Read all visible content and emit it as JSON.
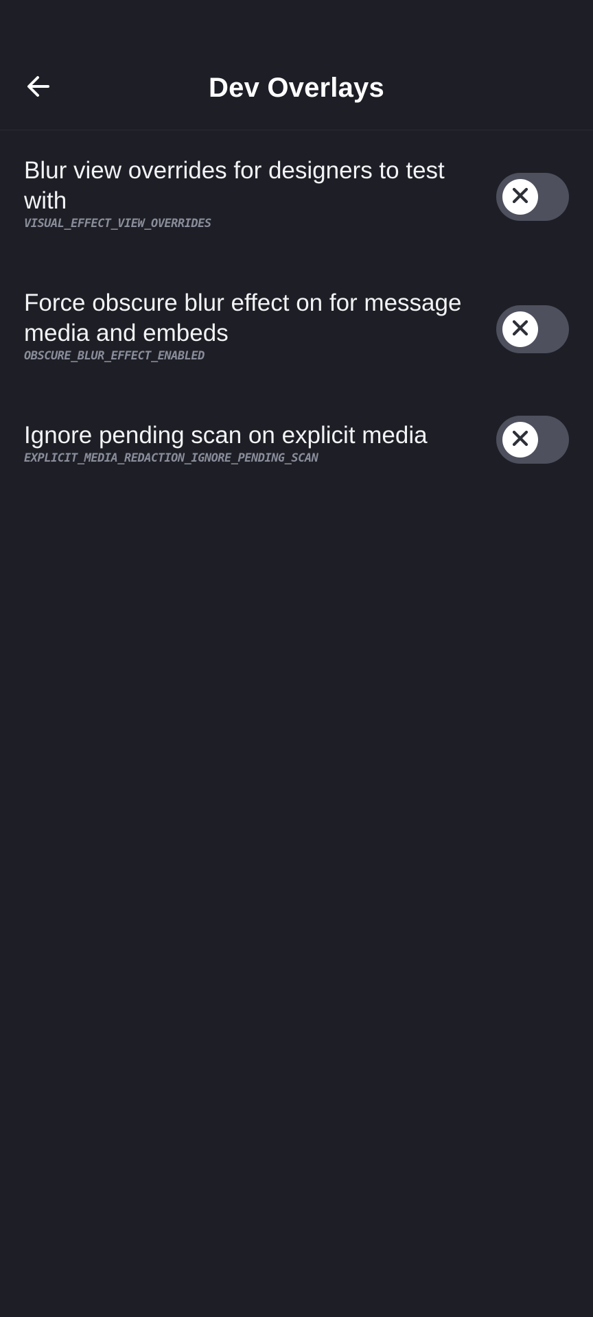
{
  "header": {
    "title": "Dev Overlays",
    "back_icon": "arrow-left-icon"
  },
  "colors": {
    "background": "#1e1f26",
    "toggle_off_track": "#4e505e",
    "toggle_knob": "#ffffff",
    "subtext": "#8a8d9a"
  },
  "settings": [
    {
      "label": "Blur view overrides for designers to test with",
      "key": "VISUAL_EFFECT_VIEW_OVERRIDES",
      "enabled": false
    },
    {
      "label": "Force obscure blur effect on for message media and embeds",
      "key": "OBSCURE_BLUR_EFFECT_ENABLED",
      "enabled": false
    },
    {
      "label": "Ignore pending scan on explicit media",
      "key": "EXPLICIT_MEDIA_REDACTION_IGNORE_PENDING_SCAN",
      "enabled": false
    }
  ]
}
